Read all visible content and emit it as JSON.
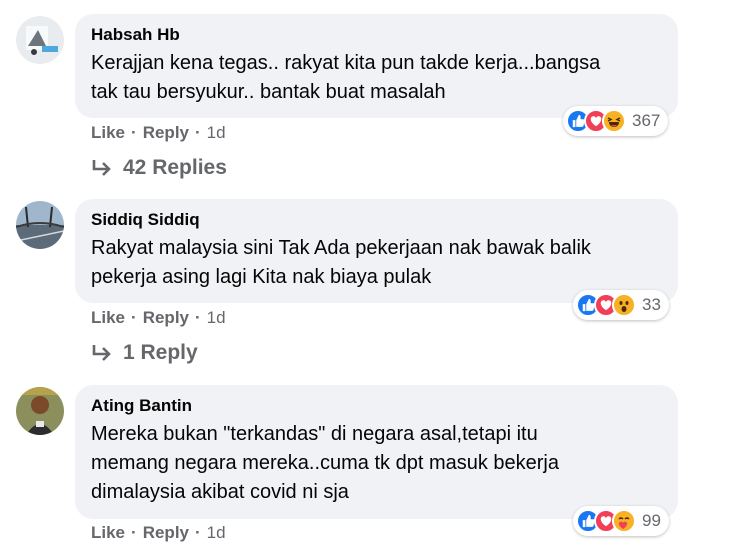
{
  "comments": [
    {
      "author": "Habsah Hb",
      "text_line1": "Kerajjan kena tegas.. rakyat kita pun takde kerja...bangsa",
      "text_line2": "tak tau bersyukur.. bantak buat masalah",
      "reaction_count": "367",
      "reactions": [
        "like-icon",
        "love-icon",
        "haha-icon"
      ],
      "like_label": "Like",
      "reply_label": "Reply",
      "time": "1d",
      "replies_label": "42 Replies"
    },
    {
      "author": "Siddiq Siddiq",
      "text_line1": "Rakyat malaysia sini Tak Ada pekerjaan nak bawak balik",
      "text_line2": "pekerja asing lagi Kita nak biaya pulak",
      "reaction_count": "33",
      "reactions": [
        "like-icon",
        "love-icon",
        "wow-icon"
      ],
      "like_label": "Like",
      "reply_label": "Reply",
      "time": "1d",
      "replies_label": "1 Reply"
    },
    {
      "author": "Ating Bantin",
      "text_line1": "Mereka bukan \"terkandas\" di negara asal,tetapi itu",
      "text_line2": "memang negara mereka..cuma tk dpt masuk bekerja",
      "text_line3": "dimalaysia akibat covid ni sja",
      "reaction_count": "99",
      "reactions": [
        "like-icon",
        "love-icon",
        "care-icon"
      ],
      "like_label": "Like",
      "reply_label": "Reply",
      "time": "1d"
    }
  ],
  "colors": {
    "bubble": "#f0f2f5",
    "meta": "#65676b",
    "like": "#1877f2",
    "love": "#f33e58",
    "emoji": "#f7b125"
  }
}
